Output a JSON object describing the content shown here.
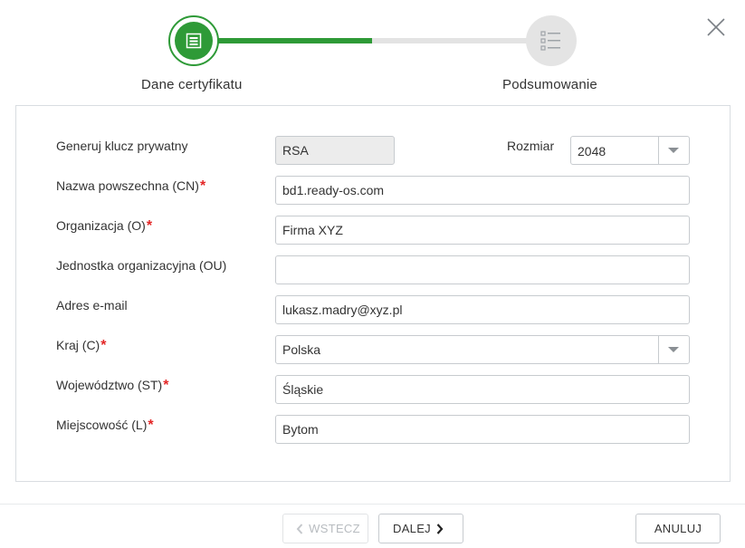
{
  "wizard": {
    "progress": 0.5,
    "steps": [
      {
        "label": "Dane certyfikatu",
        "icon": "certificate-form-icon",
        "state": "active"
      },
      {
        "label": "Podsumowanie",
        "icon": "checklist-icon",
        "state": "pending"
      }
    ],
    "close_icon": "close-icon"
  },
  "form": {
    "private_key": {
      "label": "Generuj klucz prywatny",
      "value": "RSA"
    },
    "key_size": {
      "label": "Rozmiar",
      "value": "2048"
    },
    "common_name": {
      "label": "Nazwa powszechna (CN)",
      "required_mark": "*",
      "value": "bd1.ready-os.com"
    },
    "organization": {
      "label": "Organizacja (O)",
      "required_mark": "*",
      "value": "Firma XYZ"
    },
    "org_unit": {
      "label": "Jednostka organizacyjna (OU)",
      "value": ""
    },
    "email": {
      "label": "Adres e-mail",
      "value": "lukasz.madry@xyz.pl"
    },
    "country": {
      "label": "Kraj (C)",
      "required_mark": "*",
      "value": "Polska"
    },
    "state": {
      "label": "Województwo (ST)",
      "required_mark": "*",
      "value": "Śląskie"
    },
    "locality": {
      "label": "Miejscowość (L)",
      "required_mark": "*",
      "value": "Bytom"
    }
  },
  "footer": {
    "back_label": "WSTECZ",
    "next_label": "DALEJ",
    "cancel_label": "ANULUJ"
  },
  "colors": {
    "accent": "#2e9a37",
    "required": "#e32626",
    "inactive_step": "#e4e4e4"
  }
}
